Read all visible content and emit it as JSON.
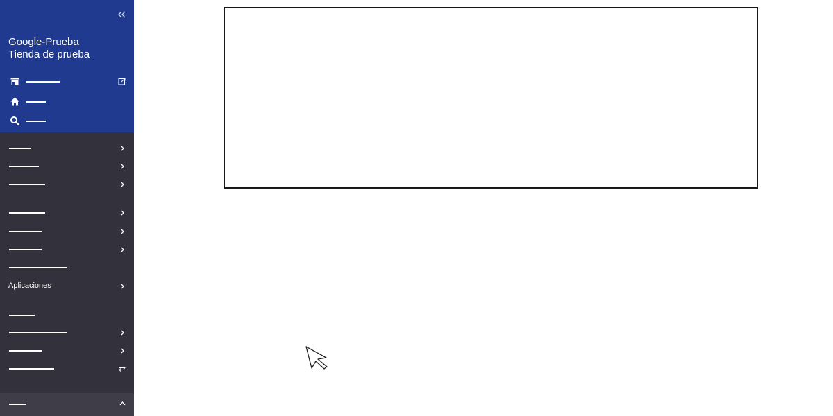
{
  "sidebar": {
    "store_name_line1": "Google-Prueba",
    "store_name_line2": "Tienda de prueba",
    "collapse_icon": "double-chevron-left-icon",
    "top_items": [
      {
        "icon": "store-icon",
        "external": true
      },
      {
        "icon": "home-icon"
      },
      {
        "icon": "search-icon"
      }
    ],
    "nav_items_visible_label": "Aplicaciones"
  },
  "colors": {
    "sidebar_top_bg": "#1f3a8f",
    "sidebar_bg": "#33313b",
    "bottom_panel_bg": "#3f3d48"
  }
}
